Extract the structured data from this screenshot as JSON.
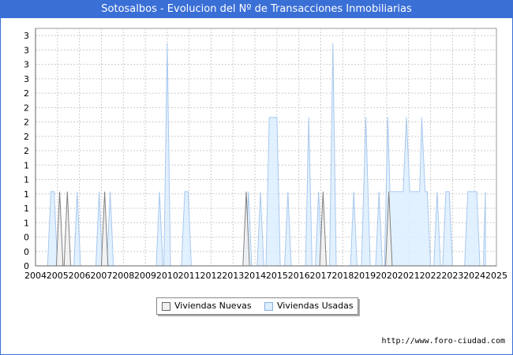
{
  "title": "Sotosalbos - Evolucion del Nº de Transacciones Inmobiliarias",
  "source": "http://www.foro-ciudad.com",
  "colors": {
    "title_bg": "#3a6fd6",
    "nuevas_fill": "#f0f0f0",
    "nuevas_line": "#808080",
    "usadas_fill": "#ddeeff",
    "usadas_line": "#a8c8ee",
    "grid": "#cccccc"
  },
  "chart_data": {
    "type": "area",
    "title": "Sotosalbos - Evolucion del Nº de Transacciones Inmobiliarias",
    "x_tick_labels": [
      "2004",
      "2005",
      "2006",
      "2007",
      "2008",
      "2009",
      "2010",
      "2011",
      "2012",
      "2013",
      "2014",
      "2015",
      "2016",
      "2017",
      "2018",
      "2019",
      "2020",
      "2021",
      "2022",
      "2023",
      "2024",
      "2025"
    ],
    "y_tick_labels": [
      "0",
      "0",
      "0",
      "1",
      "1",
      "1",
      "1",
      "1",
      "2",
      "2",
      "2",
      "2",
      "2",
      "3",
      "3",
      "3",
      "3"
    ],
    "xlim": [
      2004,
      2025
    ],
    "ylim": [
      0,
      3.2
    ],
    "grid": true,
    "legend_position": "bottom",
    "series": [
      {
        "name": "Viviendas Nuevas",
        "points": [
          [
            2004.95,
            0
          ],
          [
            2005.1,
            1
          ],
          [
            2005.25,
            0
          ],
          [
            2005.3,
            0
          ],
          [
            2005.45,
            1
          ],
          [
            2005.6,
            0
          ],
          [
            2007.0,
            0
          ],
          [
            2007.15,
            1
          ],
          [
            2007.3,
            0
          ],
          [
            2013.45,
            0
          ],
          [
            2013.6,
            1
          ],
          [
            2013.75,
            0
          ],
          [
            2016.95,
            0
          ],
          [
            2017.1,
            1
          ],
          [
            2017.25,
            0
          ],
          [
            2019.95,
            0
          ],
          [
            2020.1,
            1
          ],
          [
            2020.25,
            0
          ]
        ]
      },
      {
        "name": "Viviendas Usadas",
        "points": [
          [
            2004.55,
            0
          ],
          [
            2004.7,
            1
          ],
          [
            2004.85,
            1
          ],
          [
            2005.0,
            0
          ],
          [
            2005.75,
            0
          ],
          [
            2005.9,
            1
          ],
          [
            2006.05,
            0
          ],
          [
            2006.75,
            0
          ],
          [
            2006.9,
            1
          ],
          [
            2007.05,
            0
          ],
          [
            2007.25,
            0
          ],
          [
            2007.4,
            1
          ],
          [
            2007.55,
            0
          ],
          [
            2009.5,
            0
          ],
          [
            2009.65,
            1
          ],
          [
            2009.8,
            0
          ],
          [
            2009.85,
            0
          ],
          [
            2010.0,
            3
          ],
          [
            2010.15,
            0
          ],
          [
            2010.65,
            0
          ],
          [
            2010.8,
            1
          ],
          [
            2010.95,
            1
          ],
          [
            2011.1,
            0
          ],
          [
            2013.55,
            0
          ],
          [
            2013.7,
            1
          ],
          [
            2013.85,
            0
          ],
          [
            2014.1,
            0
          ],
          [
            2014.25,
            1
          ],
          [
            2014.4,
            0
          ],
          [
            2014.5,
            0
          ],
          [
            2014.65,
            2
          ],
          [
            2015.0,
            2
          ],
          [
            2015.15,
            0
          ],
          [
            2015.35,
            0
          ],
          [
            2015.5,
            1
          ],
          [
            2015.65,
            0
          ],
          [
            2016.3,
            0
          ],
          [
            2016.45,
            2
          ],
          [
            2016.6,
            0
          ],
          [
            2016.75,
            0
          ],
          [
            2016.9,
            1
          ],
          [
            2017.05,
            0
          ],
          [
            2017.4,
            0
          ],
          [
            2017.55,
            3
          ],
          [
            2017.7,
            0
          ],
          [
            2018.35,
            0
          ],
          [
            2018.5,
            1
          ],
          [
            2018.65,
            0
          ],
          [
            2018.85,
            0
          ],
          [
            2019.05,
            2
          ],
          [
            2019.25,
            0
          ],
          [
            2019.5,
            0
          ],
          [
            2019.65,
            1
          ],
          [
            2019.8,
            0
          ],
          [
            2019.9,
            0
          ],
          [
            2020.05,
            2
          ],
          [
            2020.15,
            1
          ],
          [
            2020.4,
            1
          ],
          [
            2020.5,
            1
          ],
          [
            2020.6,
            1
          ],
          [
            2020.75,
            1
          ],
          [
            2020.9,
            2
          ],
          [
            2021.05,
            1
          ],
          [
            2021.2,
            1
          ],
          [
            2021.35,
            1
          ],
          [
            2021.5,
            1
          ],
          [
            2021.6,
            2
          ],
          [
            2021.75,
            1
          ],
          [
            2021.85,
            1
          ],
          [
            2022.0,
            0
          ],
          [
            2022.15,
            0
          ],
          [
            2022.3,
            1
          ],
          [
            2022.45,
            0
          ],
          [
            2022.55,
            0
          ],
          [
            2022.7,
            1
          ],
          [
            2022.85,
            1
          ],
          [
            2023.0,
            0
          ],
          [
            2023.55,
            0
          ],
          [
            2023.7,
            1
          ],
          [
            2023.95,
            1
          ],
          [
            2024.1,
            1
          ],
          [
            2024.25,
            0
          ],
          [
            2024.4,
            0
          ],
          [
            2024.5,
            1
          ]
        ]
      }
    ]
  }
}
